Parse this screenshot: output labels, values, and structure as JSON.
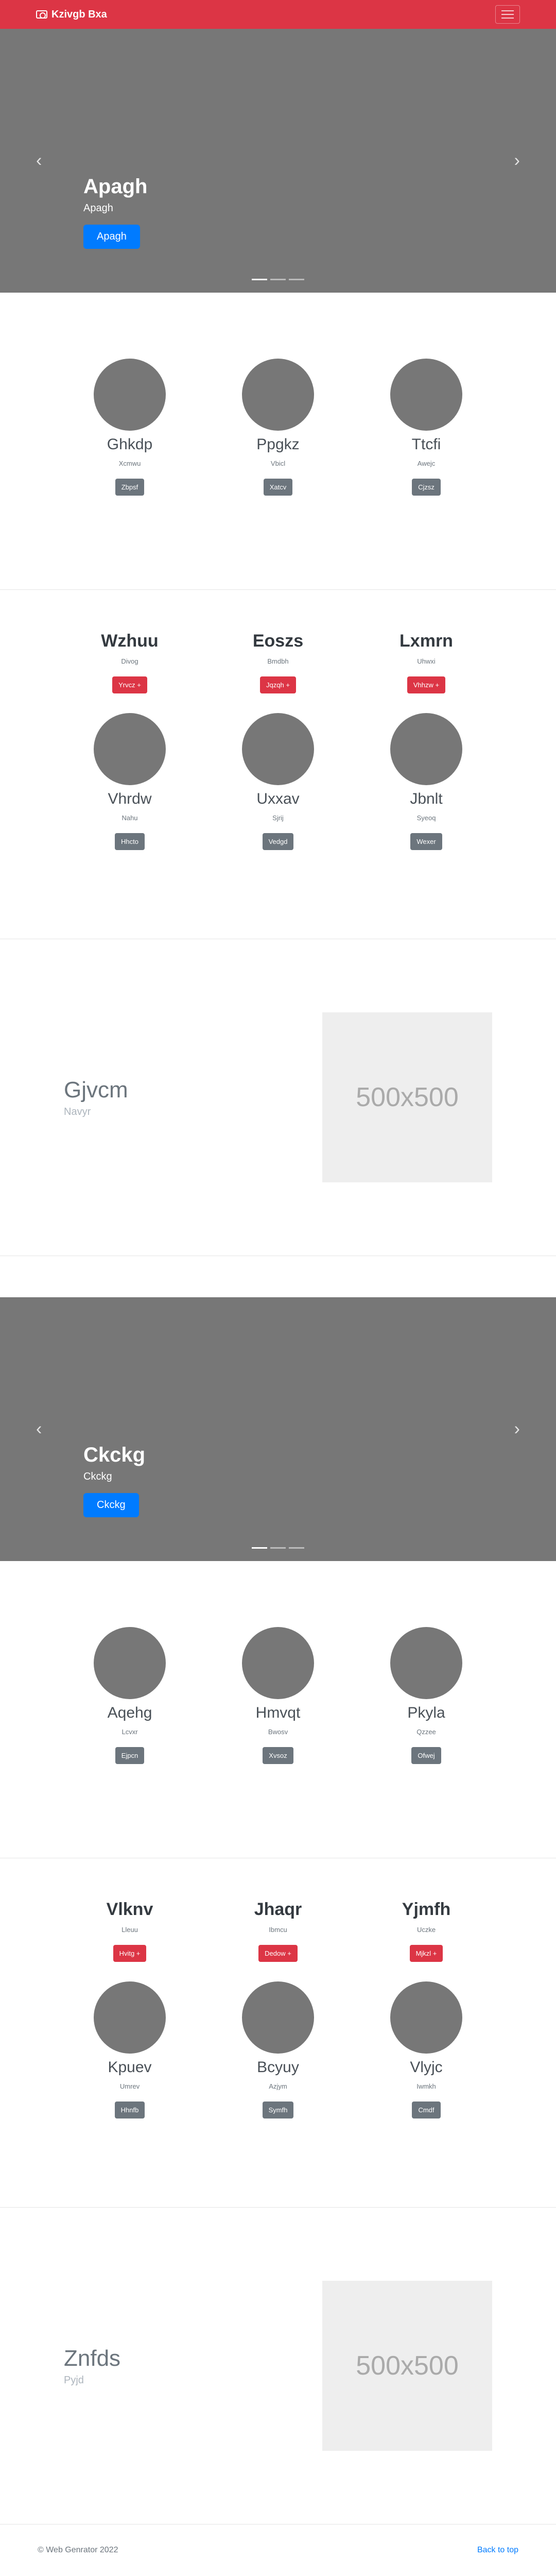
{
  "navbar": {
    "brand": "Kzivgb Bxa"
  },
  "carousel1": {
    "title": "Apagh",
    "subtitle": "Apagh",
    "button": "Apagh"
  },
  "team1": [
    {
      "name": "Ghkdp",
      "sub": "Xcmwu",
      "button": "Zbpsf"
    },
    {
      "name": "Ppgkz",
      "sub": "Vbicl",
      "button": "Xatcv"
    },
    {
      "name": "Ttcfi",
      "sub": "Awejc",
      "button": "Cjzsz"
    }
  ],
  "products1": {
    "items": [
      {
        "title": "Wzhuu",
        "sub": "Divog",
        "button": "Yrvcz +"
      },
      {
        "title": "Eoszs",
        "sub": "Bmdbh",
        "button": "Jqzqh +"
      },
      {
        "title": "Lxmrn",
        "sub": "Uhwxi",
        "button": "Vhhzw +"
      }
    ],
    "team": [
      {
        "name": "Vhrdw",
        "sub": "Nahu",
        "button": "Hhcto"
      },
      {
        "name": "Uxxav",
        "sub": "Sjrij",
        "button": "Vedgd"
      },
      {
        "name": "Jbnlt",
        "sub": "Syeoq",
        "button": "Wexer"
      }
    ]
  },
  "feature1": {
    "title": "Gjvcm",
    "sub": "Navyr",
    "placeholder": "500x500"
  },
  "carousel2": {
    "title": "Ckckg",
    "subtitle": "Ckckg",
    "button": "Ckckg"
  },
  "team2": [
    {
      "name": "Aqehg",
      "sub": "Lcvxr",
      "button": "Ejpcn"
    },
    {
      "name": "Hmvqt",
      "sub": "Bwosv",
      "button": "Xvsoz"
    },
    {
      "name": "Pkyla",
      "sub": "Qzzee",
      "button": "Ofwej"
    }
  ],
  "products2": {
    "items": [
      {
        "title": "Vlknv",
        "sub": "Lleuu",
        "button": "Hvitg +"
      },
      {
        "title": "Jhaqr",
        "sub": "Ibmcu",
        "button": "Dedow +"
      },
      {
        "title": "Yjmfh",
        "sub": "Uczke",
        "button": "Mjkzl +"
      }
    ],
    "team": [
      {
        "name": "Kpuev",
        "sub": "Umrev",
        "button": "Hhnfb"
      },
      {
        "name": "Bcyuy",
        "sub": "Azjym",
        "button": "Symfh"
      },
      {
        "name": "Vlyjc",
        "sub": "Iwmkh",
        "button": "Cmdf"
      }
    ]
  },
  "feature2": {
    "title": "Znfds",
    "sub": "Pyjd",
    "placeholder": "500x500"
  },
  "footer": {
    "copyright": "© Web Genrator 2022",
    "back": "Back to top"
  }
}
